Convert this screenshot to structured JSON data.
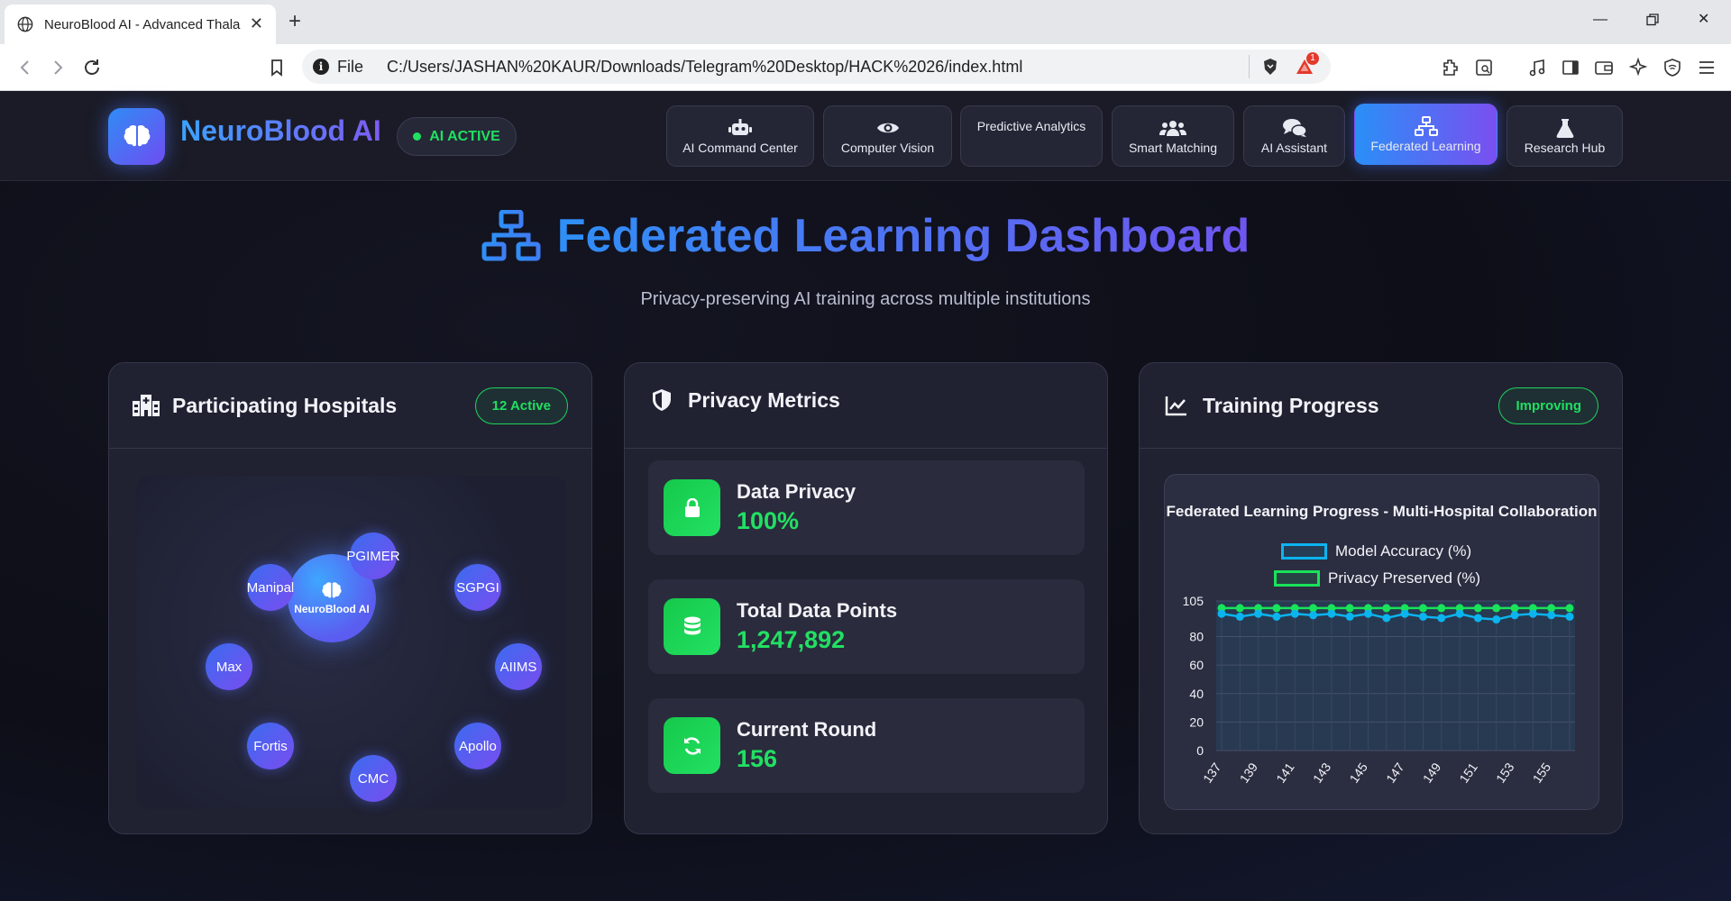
{
  "browser": {
    "tab_title": "NeuroBlood AI - Advanced Thala",
    "url_scheme": "File",
    "url": "C:/Users/JASHAN%20KAUR/Downloads/Telegram%20Desktop/HACK%2026/index.html",
    "notification_count": "1"
  },
  "header": {
    "brand": "NeuroBlood AI",
    "status_badge": "AI ACTIVE",
    "nav": [
      {
        "label": "AI Command Center",
        "icon": "robot-icon"
      },
      {
        "label": "Computer Vision",
        "icon": "eye-icon"
      },
      {
        "label": "Predictive Analytics",
        "icon": ""
      },
      {
        "label": "Smart Matching",
        "icon": "users-icon"
      },
      {
        "label": "AI Assistant",
        "icon": "chat-icon"
      },
      {
        "label": "Federated Learning",
        "icon": "network-icon",
        "active": true
      },
      {
        "label": "Research Hub",
        "icon": "flask-icon"
      }
    ]
  },
  "page": {
    "title": "Federated Learning Dashboard",
    "subtitle": "Privacy-preserving AI training across multiple institutions"
  },
  "hospitals": {
    "title": "Participating Hospitals",
    "badge": "12 Active",
    "center_label": "NeuroBlood AI",
    "nodes": [
      "PGIMER",
      "SGPGI",
      "AIIMS",
      "Apollo",
      "CMC",
      "Fortis",
      "Max",
      "Manipal"
    ]
  },
  "privacy": {
    "title": "Privacy Metrics",
    "metrics": [
      {
        "label": "Data Privacy",
        "value": "100%",
        "icon": "lock-icon"
      },
      {
        "label": "Total Data Points",
        "value": "1,247,892",
        "icon": "database-icon"
      },
      {
        "label": "Current Round",
        "value": "156",
        "icon": "sync-icon"
      }
    ]
  },
  "training": {
    "title": "Training Progress",
    "badge": "Improving"
  },
  "colors": {
    "accent_blue": "#2f8ff7",
    "accent_purple": "#7a4ff0",
    "success_green": "#22e063",
    "accuracy_line": "#0bb4ef",
    "privacy_line": "#19e35a"
  },
  "chart_data": {
    "type": "line",
    "title": "Federated Learning Progress - Multi-Hospital Collaboration",
    "x": [
      137,
      138,
      139,
      140,
      141,
      142,
      143,
      144,
      145,
      146,
      147,
      148,
      149,
      150,
      151,
      152,
      153,
      154,
      155,
      156
    ],
    "x_tick_labels": [
      "137",
      "139",
      "141",
      "143",
      "145",
      "147",
      "149",
      "151",
      "153",
      "155"
    ],
    "series": [
      {
        "name": "Model Accuracy (%)",
        "values": [
          96,
          94,
          96,
          94,
          96,
          95,
          96,
          94,
          96,
          93,
          96,
          94,
          93,
          96,
          93,
          92,
          95,
          96,
          95,
          94
        ]
      },
      {
        "name": "Privacy Preserved (%)",
        "values": [
          100,
          100,
          100,
          100,
          100,
          100,
          100,
          100,
          100,
          100,
          100,
          100,
          100,
          100,
          100,
          100,
          100,
          100,
          100,
          100
        ]
      }
    ],
    "ylim": [
      0,
      105
    ],
    "y_ticks": [
      0,
      20,
      40,
      60,
      80,
      105
    ],
    "xlabel": "",
    "ylabel": "",
    "grid": true,
    "legend": "top-center"
  }
}
